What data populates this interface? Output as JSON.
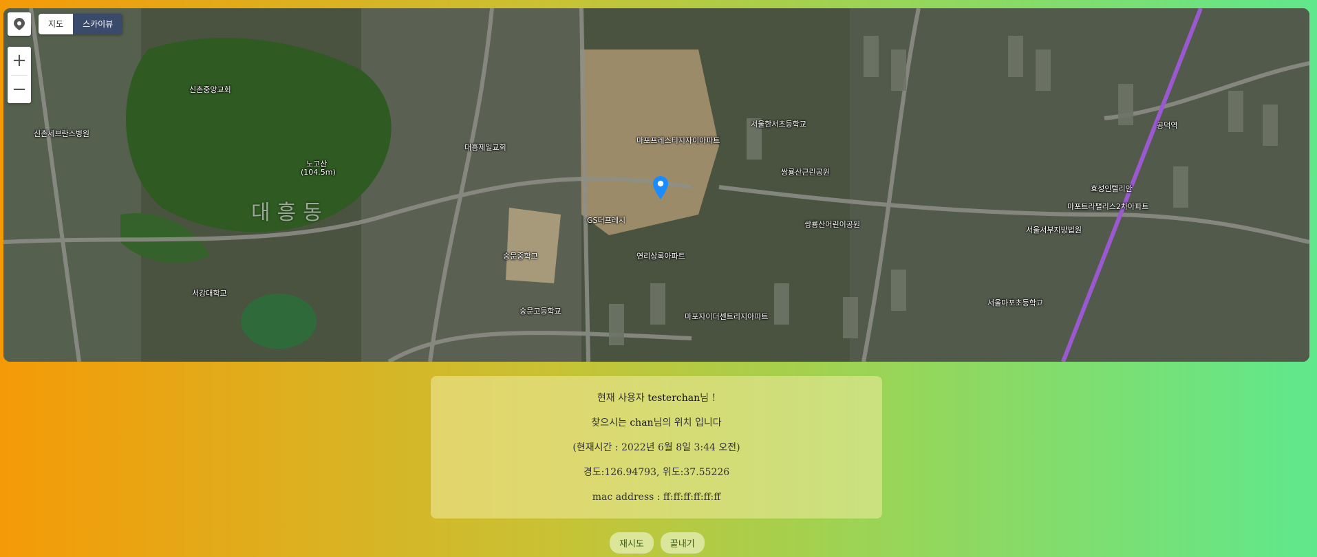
{
  "map": {
    "type_options": [
      "지도",
      "스카이뷰"
    ],
    "selected_type": "스카이뷰",
    "zoom_in": "+",
    "zoom_out": "−",
    "labels": {
      "area_big": "대흥동",
      "mountain": "노고산",
      "mountain_height": "(104.5m)",
      "school_1": "서강대학교",
      "school_2": "숭문중학교",
      "school_3": "숭문고등학교",
      "apartment_1": "마포프레스티지자이아파트",
      "apartment_2": "연리상록아파트",
      "apartment_3": "마포자이더센트리지아파트",
      "building_1": "GS더프레시",
      "park_1": "쌍룡산근린공원",
      "park_2": "쌍룡산어린이공원",
      "school_4": "서울한서초등학교",
      "school_5": "서울서부지방법원",
      "apartment_4": "마포트라팰리스2차아파트",
      "apartment_5": "효성인텔리안",
      "station": "공덕역",
      "hospital": "신촌세브란스병원",
      "church": "신촌중앙교회",
      "store": "대흥제일교회",
      "school_6": "서울마포초등학교"
    }
  },
  "info": {
    "user_prefix": "현재 사용자 ",
    "user_name": "testerchan",
    "user_suffix": "님 !",
    "target_prefix": "찾으시는 ",
    "target_name": "chan",
    "target_suffix": "님의 위치 입니다",
    "time_text": "(현재시간 : 2022년 6월 8일 3:44 오전)",
    "coords_text": "경도:126.94793, 위도:37.55226",
    "mac_text": "mac address : ff:ff:ff:ff:ff:ff"
  },
  "buttons": {
    "retry_label": "재시도",
    "end_label": "끝내기"
  },
  "colors": {
    "gradient_start": "#f59a07",
    "gradient_end": "#5fe88c",
    "marker": "#1a8cff"
  }
}
